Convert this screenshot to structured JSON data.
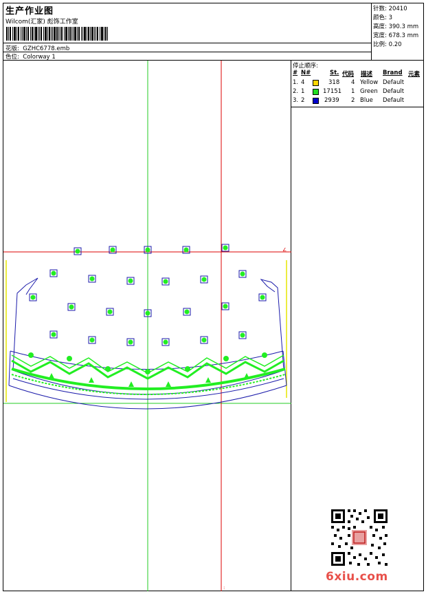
{
  "header": {
    "title": "生产作业图",
    "company": "Wilcom(汇家) 彪饰工作室",
    "design_label": "花版:",
    "design_value": "GZHC6778.emb",
    "colorway_label": "色位:",
    "colorway_value": "Colorway 1"
  },
  "stats": [
    {
      "label": "针数:",
      "value": "20410"
    },
    {
      "label": "颜色:",
      "value": "3"
    },
    {
      "label": "高度:",
      "value": "390.3 mm"
    },
    {
      "label": "宽度:",
      "value": "678.3 mm"
    },
    {
      "label": "比例:",
      "value": "0.20"
    }
  ],
  "stop_sequence": {
    "title": "停止顺序:",
    "columns": [
      "#",
      "N#",
      "St.",
      "代码",
      "描述",
      "Brand",
      "元素"
    ],
    "rows": [
      {
        "index": "1.",
        "n": "4",
        "color": "#ffd600",
        "stitches": "318",
        "code": "4",
        "desc": "Yellow",
        "brand": "Default"
      },
      {
        "index": "2.",
        "n": "1",
        "color": "#22dd22",
        "stitches": "17151",
        "code": "1",
        "desc": "Green",
        "brand": "Default"
      },
      {
        "index": "3.",
        "n": "2",
        "color": "#0000cc",
        "stitches": "2939",
        "code": "2",
        "desc": "Blue",
        "brand": "Default"
      }
    ]
  },
  "watermark": "6xiu.com",
  "colors": {
    "guide_green": "#22cc22",
    "guide_red": "#dd0000",
    "outline_blue": "#1a1aaa",
    "motif_green": "#22ee22",
    "boundary_yellow": "#e6e600"
  }
}
